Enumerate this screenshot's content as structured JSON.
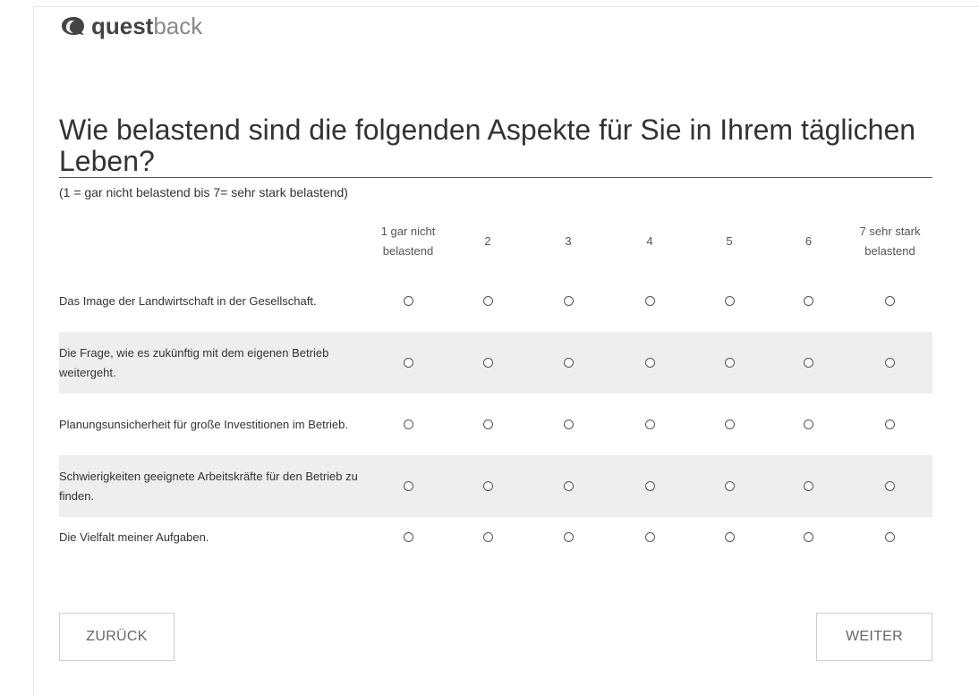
{
  "logo": {
    "quest": "quest",
    "back": "back",
    "icon": "questback-logo-icon"
  },
  "question": {
    "title": "Wie belastend sind die folgenden Aspekte für Sie in Ihrem täglichen Leben?",
    "instruction": "(1 = gar nicht belastend bis 7= sehr stark belastend)"
  },
  "scale": {
    "headers": [
      "1 gar nicht belastend",
      "2",
      "3",
      "4",
      "5",
      "6",
      "7 sehr stark belastend"
    ]
  },
  "statements": [
    "Das Image der Landwirtschaft in der Gesellschaft.",
    "Die Frage, wie es zukünftig mit dem eigenen Betrieb weitergeht.",
    "Planungsunsicherheit für große Investitionen im Betrieb.",
    "Schwierigkeiten geeignete Arbeitskräfte für den Betrieb zu finden.",
    "Die Vielfalt meiner Aufgaben."
  ],
  "buttons": {
    "back": "ZURÜCK",
    "next": "WEITER"
  },
  "colors": {
    "row_alt": "#eeeeee",
    "rule": "#555555",
    "button_border": "#cfcfcf"
  }
}
